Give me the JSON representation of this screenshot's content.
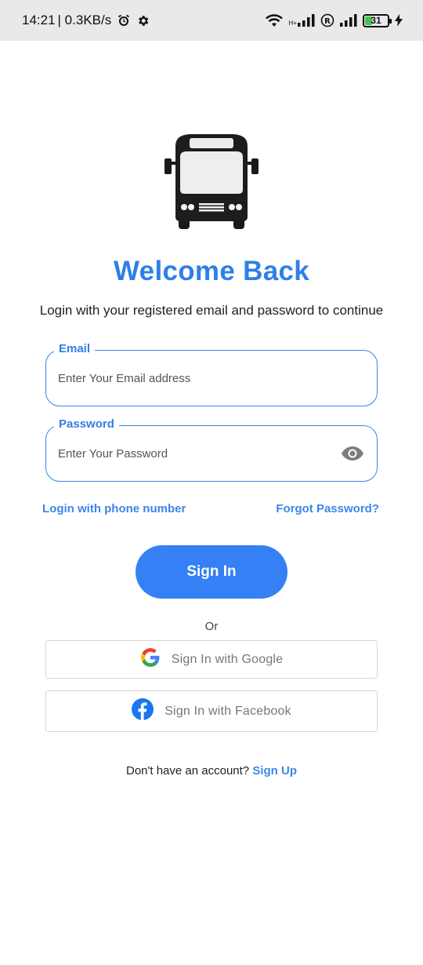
{
  "status_bar": {
    "time": "14:21",
    "speed": "| 0.3KB/s",
    "network_type": "H+",
    "battery_level": "31",
    "battery_percent": 31,
    "icons": [
      "alarm-icon",
      "settings-icon",
      "wifi-icon",
      "signal-icon",
      "roaming-icon",
      "battery-icon",
      "charging-icon"
    ]
  },
  "login": {
    "title": "Welcome Back",
    "subtitle": "Login with your registered email and password to continue",
    "email": {
      "label": "Email",
      "placeholder": "Enter Your Email address"
    },
    "password": {
      "label": "Password",
      "placeholder": "Enter Your Password"
    },
    "phone_login_link": "Login with phone number",
    "forgot_password_link": "Forgot Password?",
    "sign_in_button": "Sign In",
    "or_text": "Or",
    "google_button": "Sign In with Google",
    "facebook_button": "Sign In with Facebook",
    "no_account_text": "Don't have an account?",
    "sign_up_link": "Sign Up"
  },
  "colors": {
    "accent": "#2f7fe8",
    "button": "#3580f4",
    "facebook": "#1877f2",
    "battery": "#46c14c"
  }
}
